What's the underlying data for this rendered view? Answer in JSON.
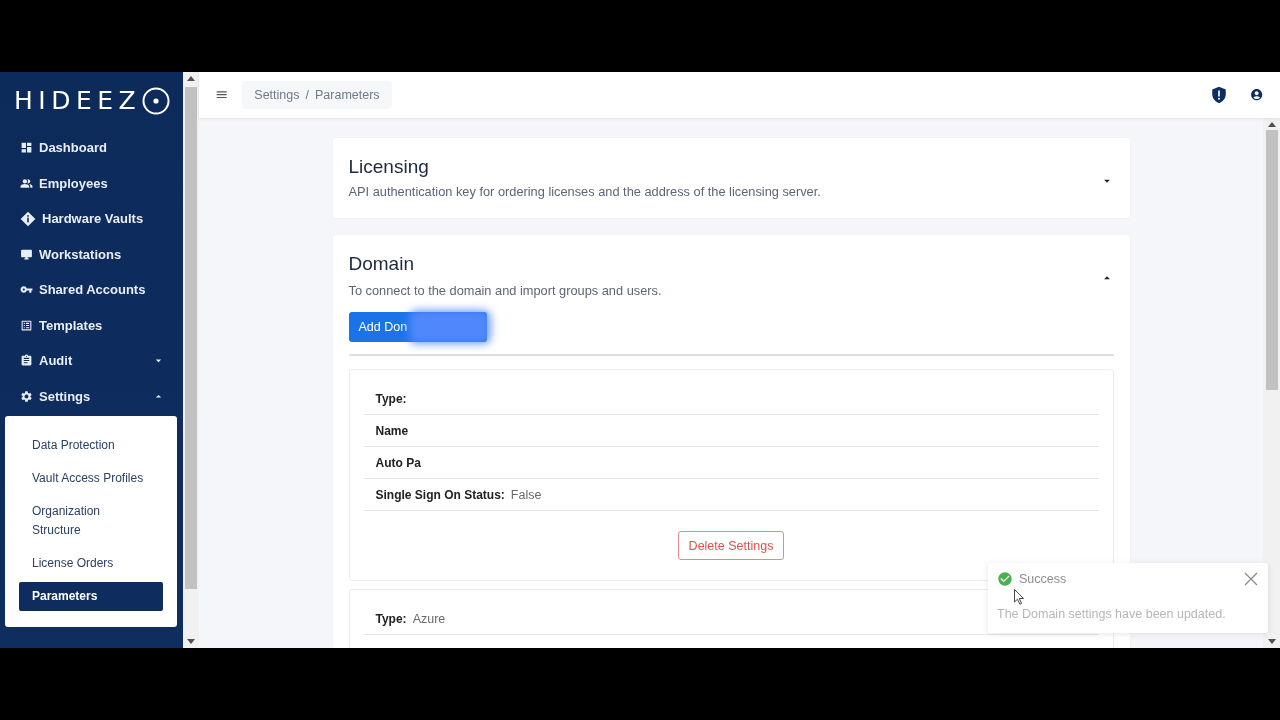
{
  "logo": {
    "text": "HIDEEZ"
  },
  "sidebar": {
    "items": [
      {
        "label": "Dashboard",
        "kind": "link",
        "selected": false
      },
      {
        "label": "Employees",
        "kind": "link",
        "selected": false
      },
      {
        "label": "Hardware Vaults",
        "kind": "link",
        "selected": false
      },
      {
        "label": "Workstations",
        "kind": "link",
        "selected": false
      },
      {
        "label": "Shared Accounts",
        "kind": "link",
        "selected": false
      },
      {
        "label": "Templates",
        "kind": "link",
        "selected": false
      },
      {
        "label": "Audit",
        "kind": "group",
        "selected": false,
        "expanded": false
      },
      {
        "label": "Settings",
        "kind": "group",
        "selected": false,
        "expanded": true,
        "children": [
          {
            "label": "Data Protection",
            "selected": false
          },
          {
            "label": "Vault Access Profiles",
            "selected": false
          },
          {
            "label": "Organization Structure",
            "selected": false
          },
          {
            "label": "License Orders",
            "selected": false
          },
          {
            "label": "Parameters",
            "selected": true
          }
        ]
      }
    ]
  },
  "header": {
    "breadcrumb": {
      "items": [
        "Settings",
        "Parameters"
      ],
      "separator": "/"
    }
  },
  "sections": [
    {
      "title": "Licensing",
      "description": "API authentication key for ordering licenses and the address of the licensing server.",
      "expanded": false
    },
    {
      "title": "Domain",
      "description": "To connect to the domain and import groups and users.",
      "expanded": true,
      "add_button": "Add Don",
      "redacted": true,
      "settings": [
        {
          "fields": [
            {
              "label": "Type:"
            },
            {
              "label": "Name"
            },
            {
              "label": "Auto Pa"
            },
            {
              "label": "Single Sign On Status:",
              "value": "False"
            }
          ],
          "delete_button": "Delete Settings"
        },
        {
          "fields": [
            {
              "label": "Type:",
              "value": "Azure"
            }
          ]
        }
      ]
    }
  ],
  "toast": {
    "kind": "success",
    "title": "Success",
    "message": "The Domain settings have been updated."
  }
}
